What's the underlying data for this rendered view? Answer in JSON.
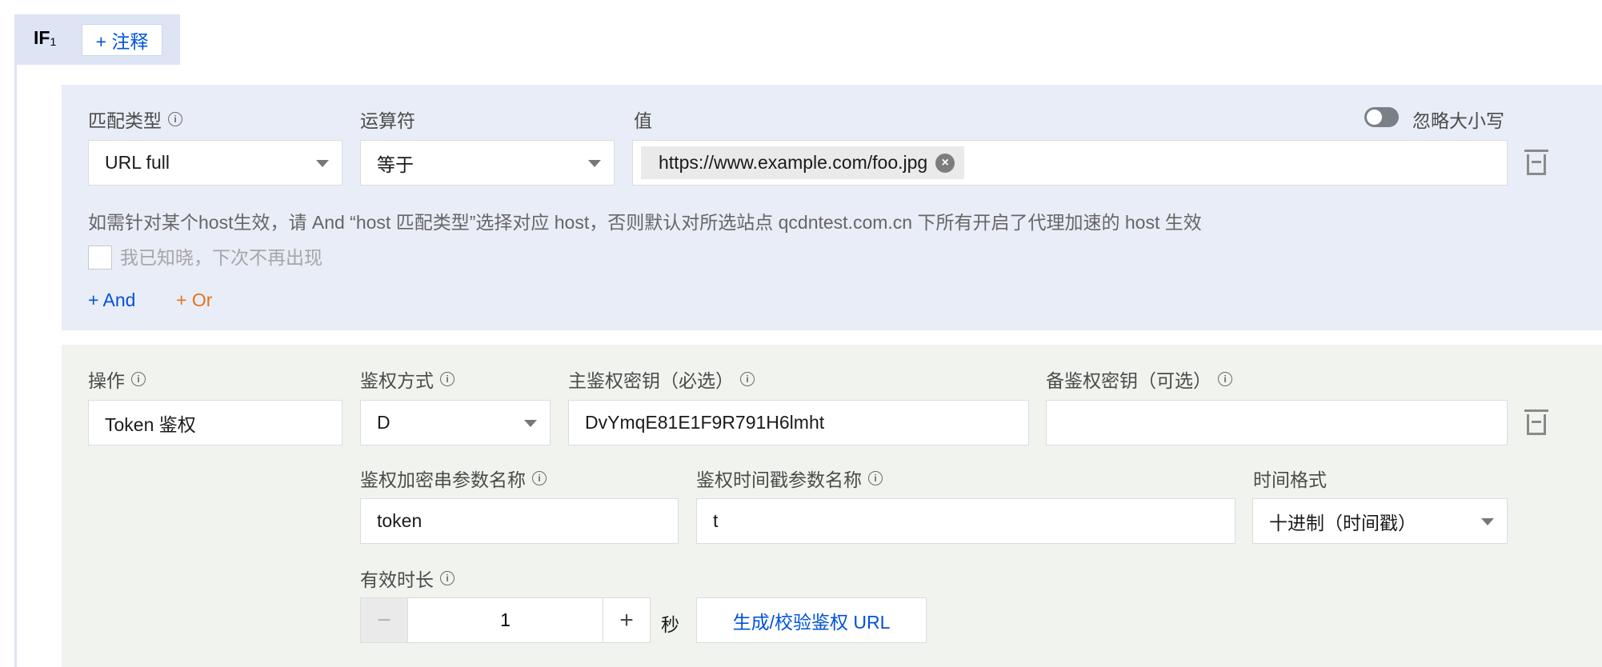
{
  "if_block": {
    "label": "IF",
    "index": "1",
    "note_button": "+ 注释"
  },
  "condition": {
    "match_type": {
      "label": "匹配类型",
      "value": "URL full"
    },
    "operator": {
      "label": "运算符",
      "value": "等于"
    },
    "value": {
      "label": "值",
      "chip": "https://www.example.com/foo.jpg"
    },
    "ignore_case": {
      "label": "忽略大小写",
      "enabled": false
    },
    "hint": "如需针对某个host生效，请 And “host 匹配类型”选择对应 host，否则默认对所选站点 qcdntest.com.cn 下所有开启了代理加速的 host 生效",
    "ack_checkbox": {
      "label": "我已知晓，下次不再出现",
      "checked": false
    },
    "add_and": "+ And",
    "add_or": "+ Or"
  },
  "operation": {
    "action": {
      "label": "操作",
      "value": "Token 鉴权"
    },
    "auth_method": {
      "label": "鉴权方式",
      "value": "D"
    },
    "primary_key": {
      "label": "主鉴权密钥（必选）",
      "value": "DvYmqE81E1F9R791H6lmht"
    },
    "backup_key": {
      "label": "备鉴权密钥（可选）",
      "value": ""
    },
    "sign_param": {
      "label": "鉴权加密串参数名称",
      "value": "token"
    },
    "time_param": {
      "label": "鉴权时间戳参数名称",
      "value": "t"
    },
    "time_format": {
      "label": "时间格式",
      "value": "十进制（时间戳）"
    },
    "validity": {
      "label": "有效时长",
      "value": "1",
      "unit": "秒",
      "minus": "−",
      "plus": "+"
    },
    "generate_button": "生成/校验鉴权 URL"
  },
  "colors": {
    "accent": "#0052d9",
    "or_link": "#e37318",
    "condition_bg": "#e9edf7",
    "operation_bg": "#f1f4ee"
  }
}
